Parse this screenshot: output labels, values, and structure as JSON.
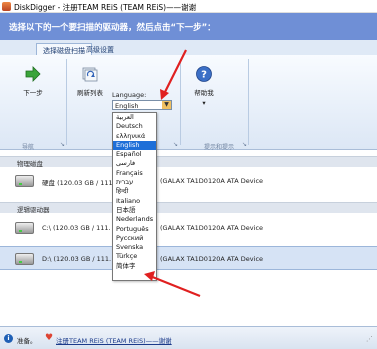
{
  "window": {
    "title": "DiskDigger - 注册TEAM REiS (TEAM REiS)——谢谢"
  },
  "banner": {
    "text": "选择以下的一个要扫描的驱动器，然后点击“下一步”："
  },
  "tabs": [
    {
      "label": "选择磁盘扫描"
    },
    {
      "label": "高级设置"
    }
  ],
  "ribbon": {
    "next_label": "下一步",
    "refresh_label": "刷新列表",
    "help_label": "帮助我",
    "help_more": "▾",
    "language_label": "Language:",
    "language_value": "English",
    "group_nav": "导航",
    "group_hint": "提示和提示"
  },
  "sections": {
    "physical": "物理磁盘",
    "logical": "逻辑驱动器"
  },
  "disks": [
    {
      "name": "硬盘 (120.03 GB / 111.",
      "rest": "(GALAX TA1D0120A ATA Device"
    },
    {
      "name": "C:\\ (120.03 GB / 111.",
      "rest": "(GALAX TA1D0120A ATA Device"
    },
    {
      "name": "D:\\ (120.03 GB / 111.",
      "rest": "(GALAX TA1D0120A ATA Device"
    }
  ],
  "languages": [
    "العربية",
    "Deutsch",
    "ελληνικά",
    "English",
    "Español",
    "فارسی",
    "Français",
    "עברית",
    "हिन्दी",
    "Italiano",
    "日本語",
    "Nederlands",
    "Português",
    "Русский",
    "Svenska",
    "Türkçe",
    "简体字"
  ],
  "selected_language": "English",
  "status": {
    "text": "准备。",
    "link": "注册TEAM REiS (TEAM REiS)——谢谢"
  },
  "colors": {
    "banner": "#6f8fd6",
    "selection": "#1e6fd8",
    "arrow": "#e02020"
  }
}
